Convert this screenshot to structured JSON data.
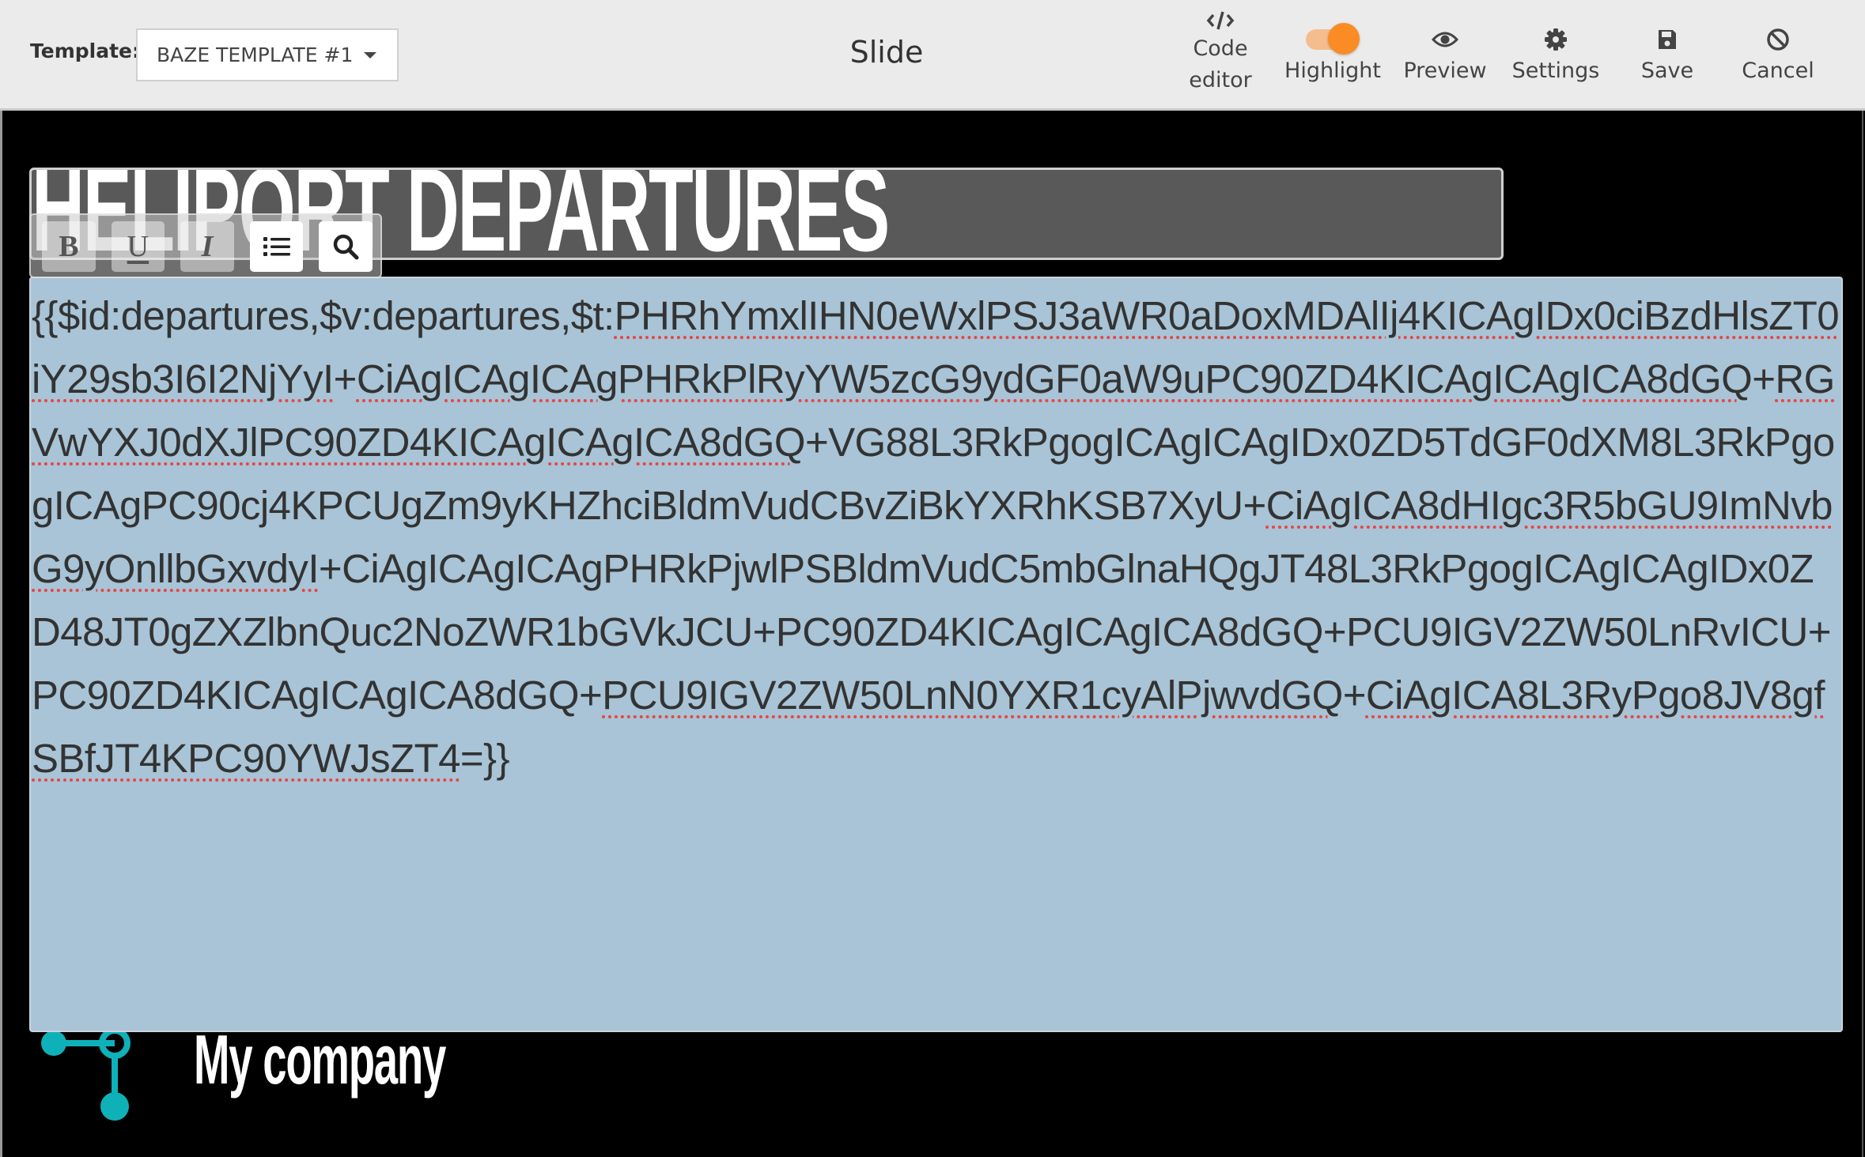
{
  "header": {
    "template_label": "Template:",
    "template_selected": "BAZE TEMPLATE #1",
    "page_title": "Slide",
    "tools": {
      "code_editor": {
        "line1": "Code",
        "line2": "editor",
        "icon": "code-icon"
      },
      "highlight": {
        "label": "Highlight",
        "enabled": true,
        "icon": "toggle"
      },
      "preview": {
        "label": "Preview",
        "icon": "eye-icon"
      },
      "settings": {
        "label": "Settings",
        "icon": "gear-icon"
      },
      "save": {
        "label": "Save",
        "icon": "floppy-disk-icon"
      },
      "cancel": {
        "label": "Cancel",
        "icon": "ban-icon"
      }
    }
  },
  "colors": {
    "accent_toggle": "#fb8b24",
    "toggle_track": "#f5bd8e",
    "text_area_bg": "#a8c4d6",
    "title_box_bg": "#595959",
    "logo_teal": "#0fb1b9"
  },
  "slide": {
    "title": "HELIPORT DEPARTURES",
    "format_toolbar": {
      "bold": "B",
      "underline": "U",
      "italic": "I",
      "list_icon": "list-icon",
      "search_icon": "search-icon"
    },
    "text_parts": [
      {
        "text": "{{$id:departures,$v:departures,$t:",
        "spell": false
      },
      {
        "text": "PHRhYmxlIHN0eWxlPSJ3aWR0aDoxMDAlIj4KICAgIDx0ciBzdHlsZT0iY29sb3I6I2NjYyI",
        "spell": true
      },
      {
        "text": "+",
        "spell": false
      },
      {
        "text": "CiAgICAgICAgPHRkPlRyYW5zcG9ydGF0aW9uPC90ZD4KICAgICAgICA8dGQ",
        "spell": true
      },
      {
        "text": "+",
        "spell": false
      },
      {
        "text": "RGVwYXJ0dXJlPC90ZD4KICAgICAgICA8dGQ",
        "spell": true
      },
      {
        "text": "+VG88L3RkPgogICAgICAgIDx0ZD5TdGF0dXM8L3RkPgogICAgPC90cj4KPCUgZm9yKHZhciBldmVudCBvZiBkYXRhKSB7XyU+",
        "spell": false
      },
      {
        "text": "CiAgICA8dHIgc3R5bGU9ImNvbG9yOnllbGxvdyI",
        "spell": true
      },
      {
        "text": "+CiAgICAgICAgPHRkPjwlPSBldmVudC5mbGlnaHQgJT48L3RkPgogICAgICAgIDx0ZD48JT0gZXZlbnQuc2NoZWR1bGVkJCU+PC90ZD4KICAgICAgICA8dGQ+PCU9IGV2ZW50LnRvICU+PC90ZD4KICAgICAgICA8dGQ+",
        "spell": false
      },
      {
        "text": "PCU9IGV2ZW50LnN0YXR1cyAlPjwvdGQ",
        "spell": true
      },
      {
        "text": "+",
        "spell": false
      },
      {
        "text": "CiAgICA8L3RyPgo8JV8gfSBfJT4KPC90YWJsZT4",
        "spell": true
      },
      {
        "text": "=}}",
        "spell": false
      }
    ]
  },
  "footer": {
    "company_name": "My company",
    "logo_icon": "network-nodes-logo"
  }
}
